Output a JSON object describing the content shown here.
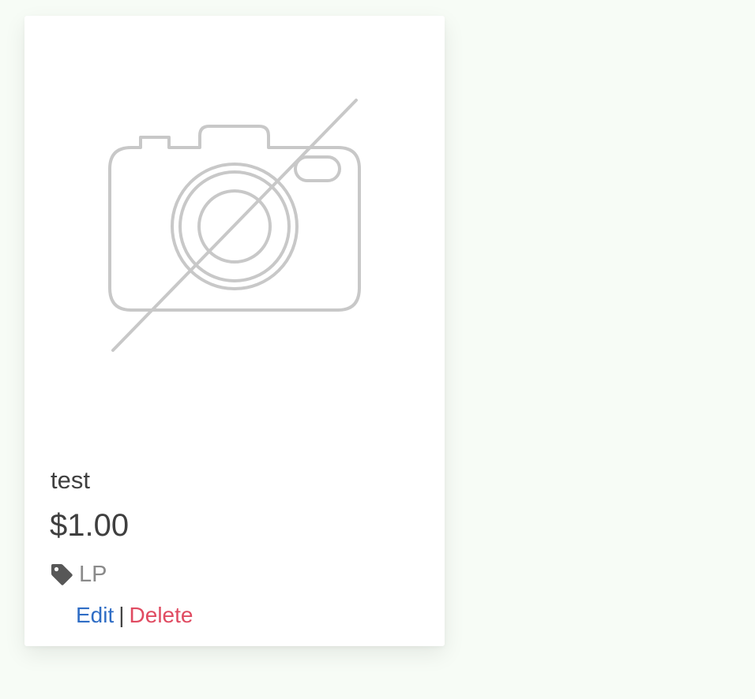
{
  "product": {
    "image_icon": "no-image-camera-icon",
    "title": "test",
    "price": "$1.00",
    "category_icon": "tag-icon",
    "category": "LP",
    "actions": {
      "edit_label": "Edit",
      "separator": "|",
      "delete_label": "Delete"
    }
  },
  "colors": {
    "page_background": "#f7fcf6",
    "card_background": "#ffffff",
    "placeholder_stroke": "#c8c8c8",
    "edit_link": "#2f6dc5",
    "delete_link": "#e04b61",
    "text_dark": "#3f3f3f",
    "text_muted": "#8a8a8a"
  }
}
